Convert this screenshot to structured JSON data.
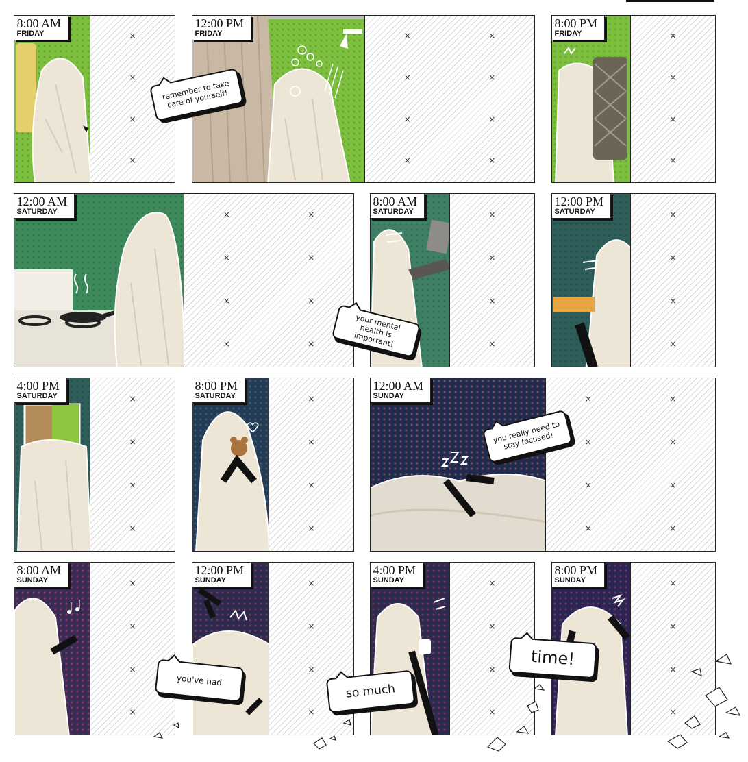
{
  "panels": [
    {
      "time": "8:00 AM",
      "day": "FRIDAY"
    },
    {
      "time": "12:00 PM",
      "day": "FRIDAY"
    },
    {
      "time": "8:00 PM",
      "day": "FRIDAY"
    },
    {
      "time": "12:00 AM",
      "day": "SATURDAY"
    },
    {
      "time": "8:00 AM",
      "day": "SATURDAY"
    },
    {
      "time": "12:00 PM",
      "day": "SATURDAY"
    },
    {
      "time": "4:00 PM",
      "day": "SATURDAY"
    },
    {
      "time": "8:00 PM",
      "day": "SATURDAY"
    },
    {
      "time": "12:00 AM",
      "day": "SUNDAY"
    },
    {
      "time": "8:00 AM",
      "day": "SUNDAY"
    },
    {
      "time": "12:00 PM",
      "day": "SUNDAY"
    },
    {
      "time": "4:00 PM",
      "day": "SUNDAY"
    },
    {
      "time": "8:00 PM",
      "day": "SUNDAY"
    }
  ],
  "bubbles": {
    "care": "remember to take care of yourself!",
    "mental": "your mental health is important!",
    "focus": "you really need to stay focused!",
    "had": "you've had",
    "somuch": "so much",
    "time": "time!"
  },
  "mark_glyph": "×",
  "colors": {
    "green": "#7dbf3e",
    "teal": "#3f7f63",
    "deep_teal": "#2f5e5a",
    "navy": "#243a55",
    "purple": "#3a2b55",
    "sheet": "#ede6d6",
    "ink": "#111111"
  },
  "icons": [
    "shower-icon",
    "bubbles-icon",
    "frying-pan-icon",
    "stove-icon",
    "laptop-icon",
    "notebook-icon",
    "teddy-bear-icon",
    "heart-icon",
    "sleep-zzz-icon",
    "music-notes-icon",
    "mug-icon",
    "cloth-icon",
    "window-icon"
  ]
}
